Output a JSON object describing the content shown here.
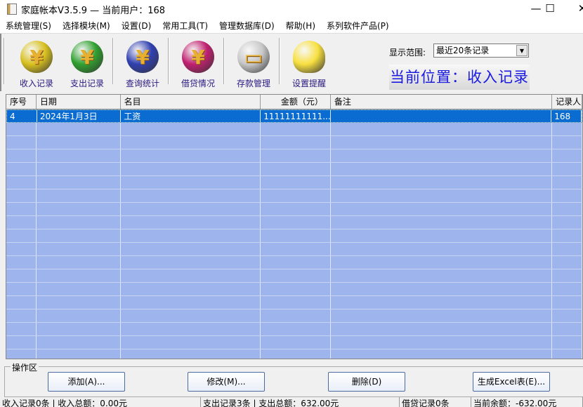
{
  "window": {
    "title": "家庭帐本V3.5.9 — 当前用户：168",
    "minimize": "—",
    "maximize": "☐",
    "close": "✕"
  },
  "menu": [
    "系统管理(S)",
    "选择模块(M)",
    "设置(D)",
    "常用工具(T)",
    "管理数据库(D)",
    "帮助(H)",
    "系列软件产品(P)"
  ],
  "toolbar": [
    {
      "label": "收入记录",
      "icon": "income-yen-icon",
      "color": "#d8c020",
      "glyph": "¥"
    },
    {
      "label": "支出记录",
      "icon": "expense-yen-icon",
      "color": "#30a030",
      "glyph": "¥"
    },
    {
      "label": "查询统计",
      "icon": "query-stats-icon",
      "color": "#3040b0",
      "glyph": "¥"
    },
    {
      "label": "借贷情况",
      "icon": "loan-icon",
      "color": "#c02070",
      "glyph": "¥"
    },
    {
      "label": "存款管理",
      "icon": "deposit-card-icon",
      "color": "#c8c8c8",
      "glyph": "▭"
    },
    {
      "label": "设置提醒",
      "icon": "lightbulb-icon",
      "color": "#f8e040",
      "glyph": ""
    }
  ],
  "range": {
    "label": "显示范围:",
    "value": "最近20条记录"
  },
  "location": "当前位置：收入记录",
  "table": {
    "headers": [
      "序号",
      "日期",
      "名目",
      "金额（元）",
      "备注",
      "记录人"
    ],
    "rows": [
      [
        "4",
        "2024年1月3日",
        "工资",
        "11111111111...",
        "",
        "168"
      ]
    ]
  },
  "ops": {
    "legend": "操作区",
    "buttons": [
      "添加(A)...",
      "修改(M)...",
      "删除(D)",
      "生成Excel表(E)..."
    ]
  },
  "status": [
    "收入记录0条 | 收入总额：0.00元",
    "支出记录3条 | 支出总额：632.00元",
    "借贷记录0条",
    "当前余额：-632.00元"
  ]
}
